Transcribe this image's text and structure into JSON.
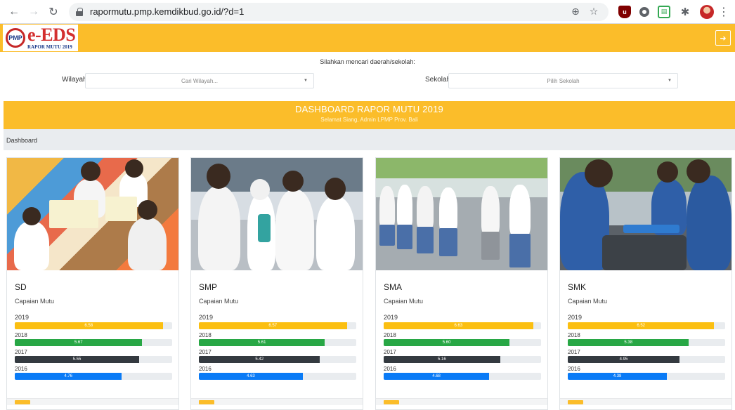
{
  "browser": {
    "url": "rapormutu.pmp.kemdikbud.go.id/?d=1",
    "icons": [
      "back-icon",
      "forward-icon",
      "reload-icon",
      "lock-icon",
      "zoom-icon",
      "star-icon",
      "ublock-icon",
      "extension-ring-icon",
      "extension-green-icon",
      "puzzle-icon",
      "profile-avatar",
      "menu-icon"
    ]
  },
  "header": {
    "logo_badge": "PMP",
    "logo_title": "e-EDS",
    "logo_subtitle": "RAPOR MUTU 2019",
    "logout_icon": "logout-icon",
    "color": "#fbbd2a"
  },
  "search": {
    "hint": "Silahkan mencari daerah/sekolah:",
    "region_label": "Wilayah",
    "region_placeholder": "Cari Wilayah...",
    "school_label": "Sekolah",
    "school_placeholder": "Pilih Sekolah"
  },
  "banner": {
    "title": "DASHBOARD RAPOR MUTU 2019",
    "subtitle": "Selamat Siang, Admin LPMP Prov. Bali"
  },
  "breadcrumb": "Dashboard",
  "colors": {
    "y2019": "#fbbf11",
    "y2018": "#28a745",
    "y2017": "#343a40",
    "y2016": "#0a7bf6"
  },
  "cards": [
    {
      "title": "SD",
      "caption": "Capaian Mutu",
      "bars": [
        {
          "year": "2019",
          "label": "6.58",
          "percent": 94
        },
        {
          "year": "2018",
          "label": "5.67",
          "percent": 81
        },
        {
          "year": "2017",
          "label": "5.55",
          "percent": 79
        },
        {
          "year": "2016",
          "label": "4.76",
          "percent": 68
        }
      ]
    },
    {
      "title": "SMP",
      "caption": "Capaian Mutu",
      "bars": [
        {
          "year": "2019",
          "label": "6.57",
          "percent": 94
        },
        {
          "year": "2018",
          "label": "5.61",
          "percent": 80
        },
        {
          "year": "2017",
          "label": "5.42",
          "percent": 77
        },
        {
          "year": "2016",
          "label": "4.63",
          "percent": 66
        }
      ]
    },
    {
      "title": "SMA",
      "caption": "Capaian Mutu",
      "bars": [
        {
          "year": "2019",
          "label": "6.63",
          "percent": 95
        },
        {
          "year": "2018",
          "label": "5.60",
          "percent": 80
        },
        {
          "year": "2017",
          "label": "5.16",
          "percent": 74
        },
        {
          "year": "2016",
          "label": "4.68",
          "percent": 67
        }
      ]
    },
    {
      "title": "SMK",
      "caption": "Capaian Mutu",
      "bars": [
        {
          "year": "2019",
          "label": "6.52",
          "percent": 93
        },
        {
          "year": "2018",
          "label": "5.38",
          "percent": 77
        },
        {
          "year": "2017",
          "label": "4.95",
          "percent": 71
        },
        {
          "year": "2016",
          "label": "4.38",
          "percent": 63
        }
      ]
    }
  ]
}
